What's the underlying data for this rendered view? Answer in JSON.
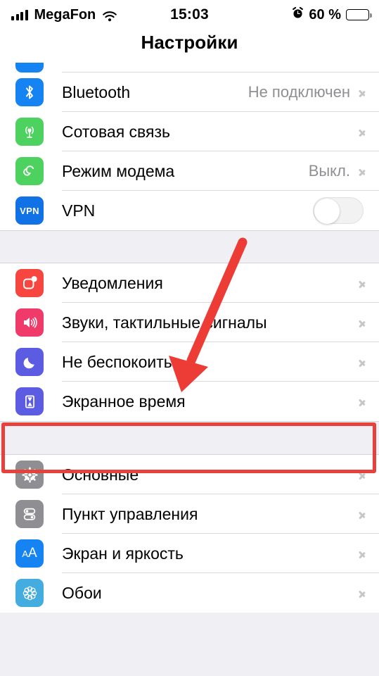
{
  "status_bar": {
    "signal_icon": "signal-bars-icon",
    "carrier": "MegaFon",
    "wifi_icon": "wifi-icon",
    "time": "15:03",
    "alarm_icon": "alarm-clock-icon",
    "battery_percent": "60 %",
    "battery_level": 60,
    "battery_icon": "battery-icon"
  },
  "header": {
    "title": "Настройки"
  },
  "sections": [
    {
      "id": "connectivity",
      "rows": [
        {
          "icon": "bluetooth-icon",
          "label": "Bluetooth",
          "value": "Не подключен",
          "accessory": "chevron"
        },
        {
          "icon": "cellular-icon",
          "label": "Сотовая связь",
          "value": "",
          "accessory": "chevron"
        },
        {
          "icon": "personal-hotspot-icon",
          "label": "Режим модема",
          "value": "Выкл.",
          "accessory": "chevron"
        },
        {
          "icon": "vpn-icon",
          "label": "VPN",
          "value": "",
          "accessory": "toggle",
          "toggle_on": false
        }
      ]
    },
    {
      "id": "alerts",
      "rows": [
        {
          "icon": "notifications-icon",
          "label": "Уведомления",
          "value": "",
          "accessory": "chevron"
        },
        {
          "icon": "sounds-icon",
          "label": "Звуки, тактильные сигналы",
          "value": "",
          "accessory": "chevron"
        },
        {
          "icon": "do-not-disturb-icon",
          "label": "Не беспокоить",
          "value": "",
          "accessory": "chevron"
        },
        {
          "icon": "screen-time-icon",
          "label": "Экранное время",
          "value": "",
          "accessory": "chevron",
          "highlighted": true
        }
      ]
    },
    {
      "id": "system",
      "rows": [
        {
          "icon": "general-gear-icon",
          "label": "Основные",
          "value": "",
          "accessory": "chevron"
        },
        {
          "icon": "control-center-icon",
          "label": "Пункт управления",
          "value": "",
          "accessory": "chevron"
        },
        {
          "icon": "display-brightness-icon",
          "label": "Экран и яркость",
          "value": "",
          "accessory": "chevron"
        },
        {
          "icon": "wallpaper-icon",
          "label": "Обои",
          "value": "",
          "accessory": "chevron"
        }
      ]
    }
  ],
  "vpn_toggle": {
    "label_state": "off"
  },
  "annotations": {
    "highlight_color": "#e8413c",
    "arrow_color": "#ed3b35",
    "highlight_target": "Экранное время",
    "arrow_points_to": "Экранное время"
  }
}
